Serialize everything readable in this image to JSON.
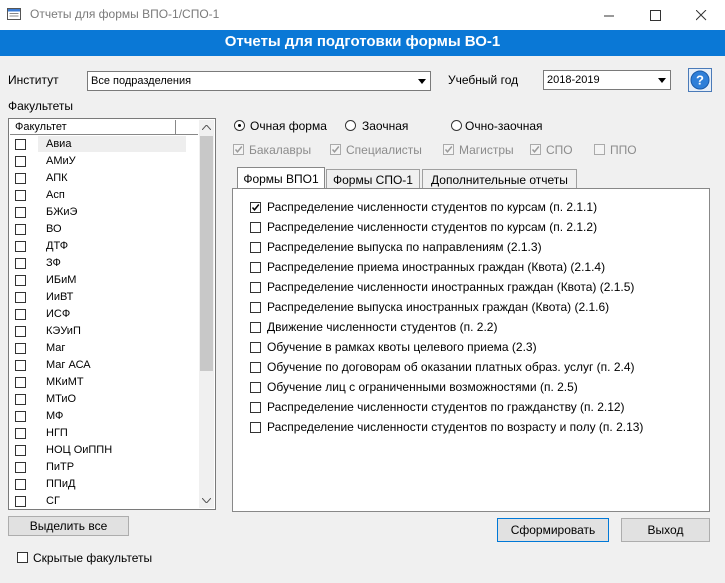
{
  "window": {
    "title": "Отчеты для формы ВПО-1/СПО-1"
  },
  "header": {
    "title": "Отчеты для подготовки формы ВО-1"
  },
  "institute": {
    "label": "Институт",
    "value": "Все подразделения"
  },
  "year": {
    "label": "Учебный год",
    "value": "2018-2019"
  },
  "faculties": {
    "label": "Факультеты",
    "column": "Факультет",
    "items": [
      "Авиа",
      "АМиУ",
      "АПК",
      "Асп",
      "БЖиЭ",
      "ВО",
      "ДТФ",
      "ЗФ",
      "ИБиМ",
      "ИиВТ",
      "ИСФ",
      "КЭУиП",
      "Маг",
      "Маг АСА",
      "МКиМТ",
      "МТиО",
      "МФ",
      "НГП",
      "НОЦ ОиППН",
      "ПиТР",
      "ППиД",
      "СГ"
    ]
  },
  "study_form": {
    "options": [
      "Очная форма",
      "Заочная",
      "Очно-заочная"
    ],
    "selected": "Очная форма"
  },
  "levels": [
    {
      "label": "Бакалавры",
      "checked": true
    },
    {
      "label": "Специалисты",
      "checked": true
    },
    {
      "label": "Магистры",
      "checked": true
    },
    {
      "label": "СПО",
      "checked": true
    },
    {
      "label": "ППО",
      "checked": false
    }
  ],
  "tabs": [
    "Формы ВПО1",
    "Формы СПО-1",
    "Дополнительные отчеты"
  ],
  "reports": [
    {
      "label": "Распределение численности студентов по курсам (п. 2.1.1)",
      "checked": true
    },
    {
      "label": "Распределение численности студентов по курсам (п. 2.1.2)",
      "checked": false
    },
    {
      "label": "Распределение выпуска по направлениям (2.1.3)",
      "checked": false
    },
    {
      "label": "Распределение приема иностранных граждан (Квота)  (2.1.4)",
      "checked": false
    },
    {
      "label": "Распределение численности иностранных граждан (Квота) (2.1.5)",
      "checked": false
    },
    {
      "label": "Распределение выпуска иностранных граждан (Квота) (2.1.6)",
      "checked": false
    },
    {
      "label": "Движение численности студентов (п. 2.2)",
      "checked": false
    },
    {
      "label": "Обучение в рамках квоты целевого приема (2.3)",
      "checked": false
    },
    {
      "label": "Обучение по договорам об оказании платных образ. услуг (п. 2.4)",
      "checked": false
    },
    {
      "label": "Обучение лиц с ограниченными возможностями (п. 2.5)",
      "checked": false
    },
    {
      "label": "Распределение численности студентов по гражданству (п. 2.12)",
      "checked": false
    },
    {
      "label": "Распределение численности студентов по возрасту и полу  (п. 2.13)",
      "checked": false
    }
  ],
  "buttons": {
    "select_all": "Выделить все",
    "generate": "Сформировать",
    "exit": "Выход"
  },
  "hidden_faculties": {
    "label": "Скрытые факультеты",
    "checked": false
  },
  "colors": {
    "header": "#0a78d6",
    "panel": "#f0f0f0"
  }
}
